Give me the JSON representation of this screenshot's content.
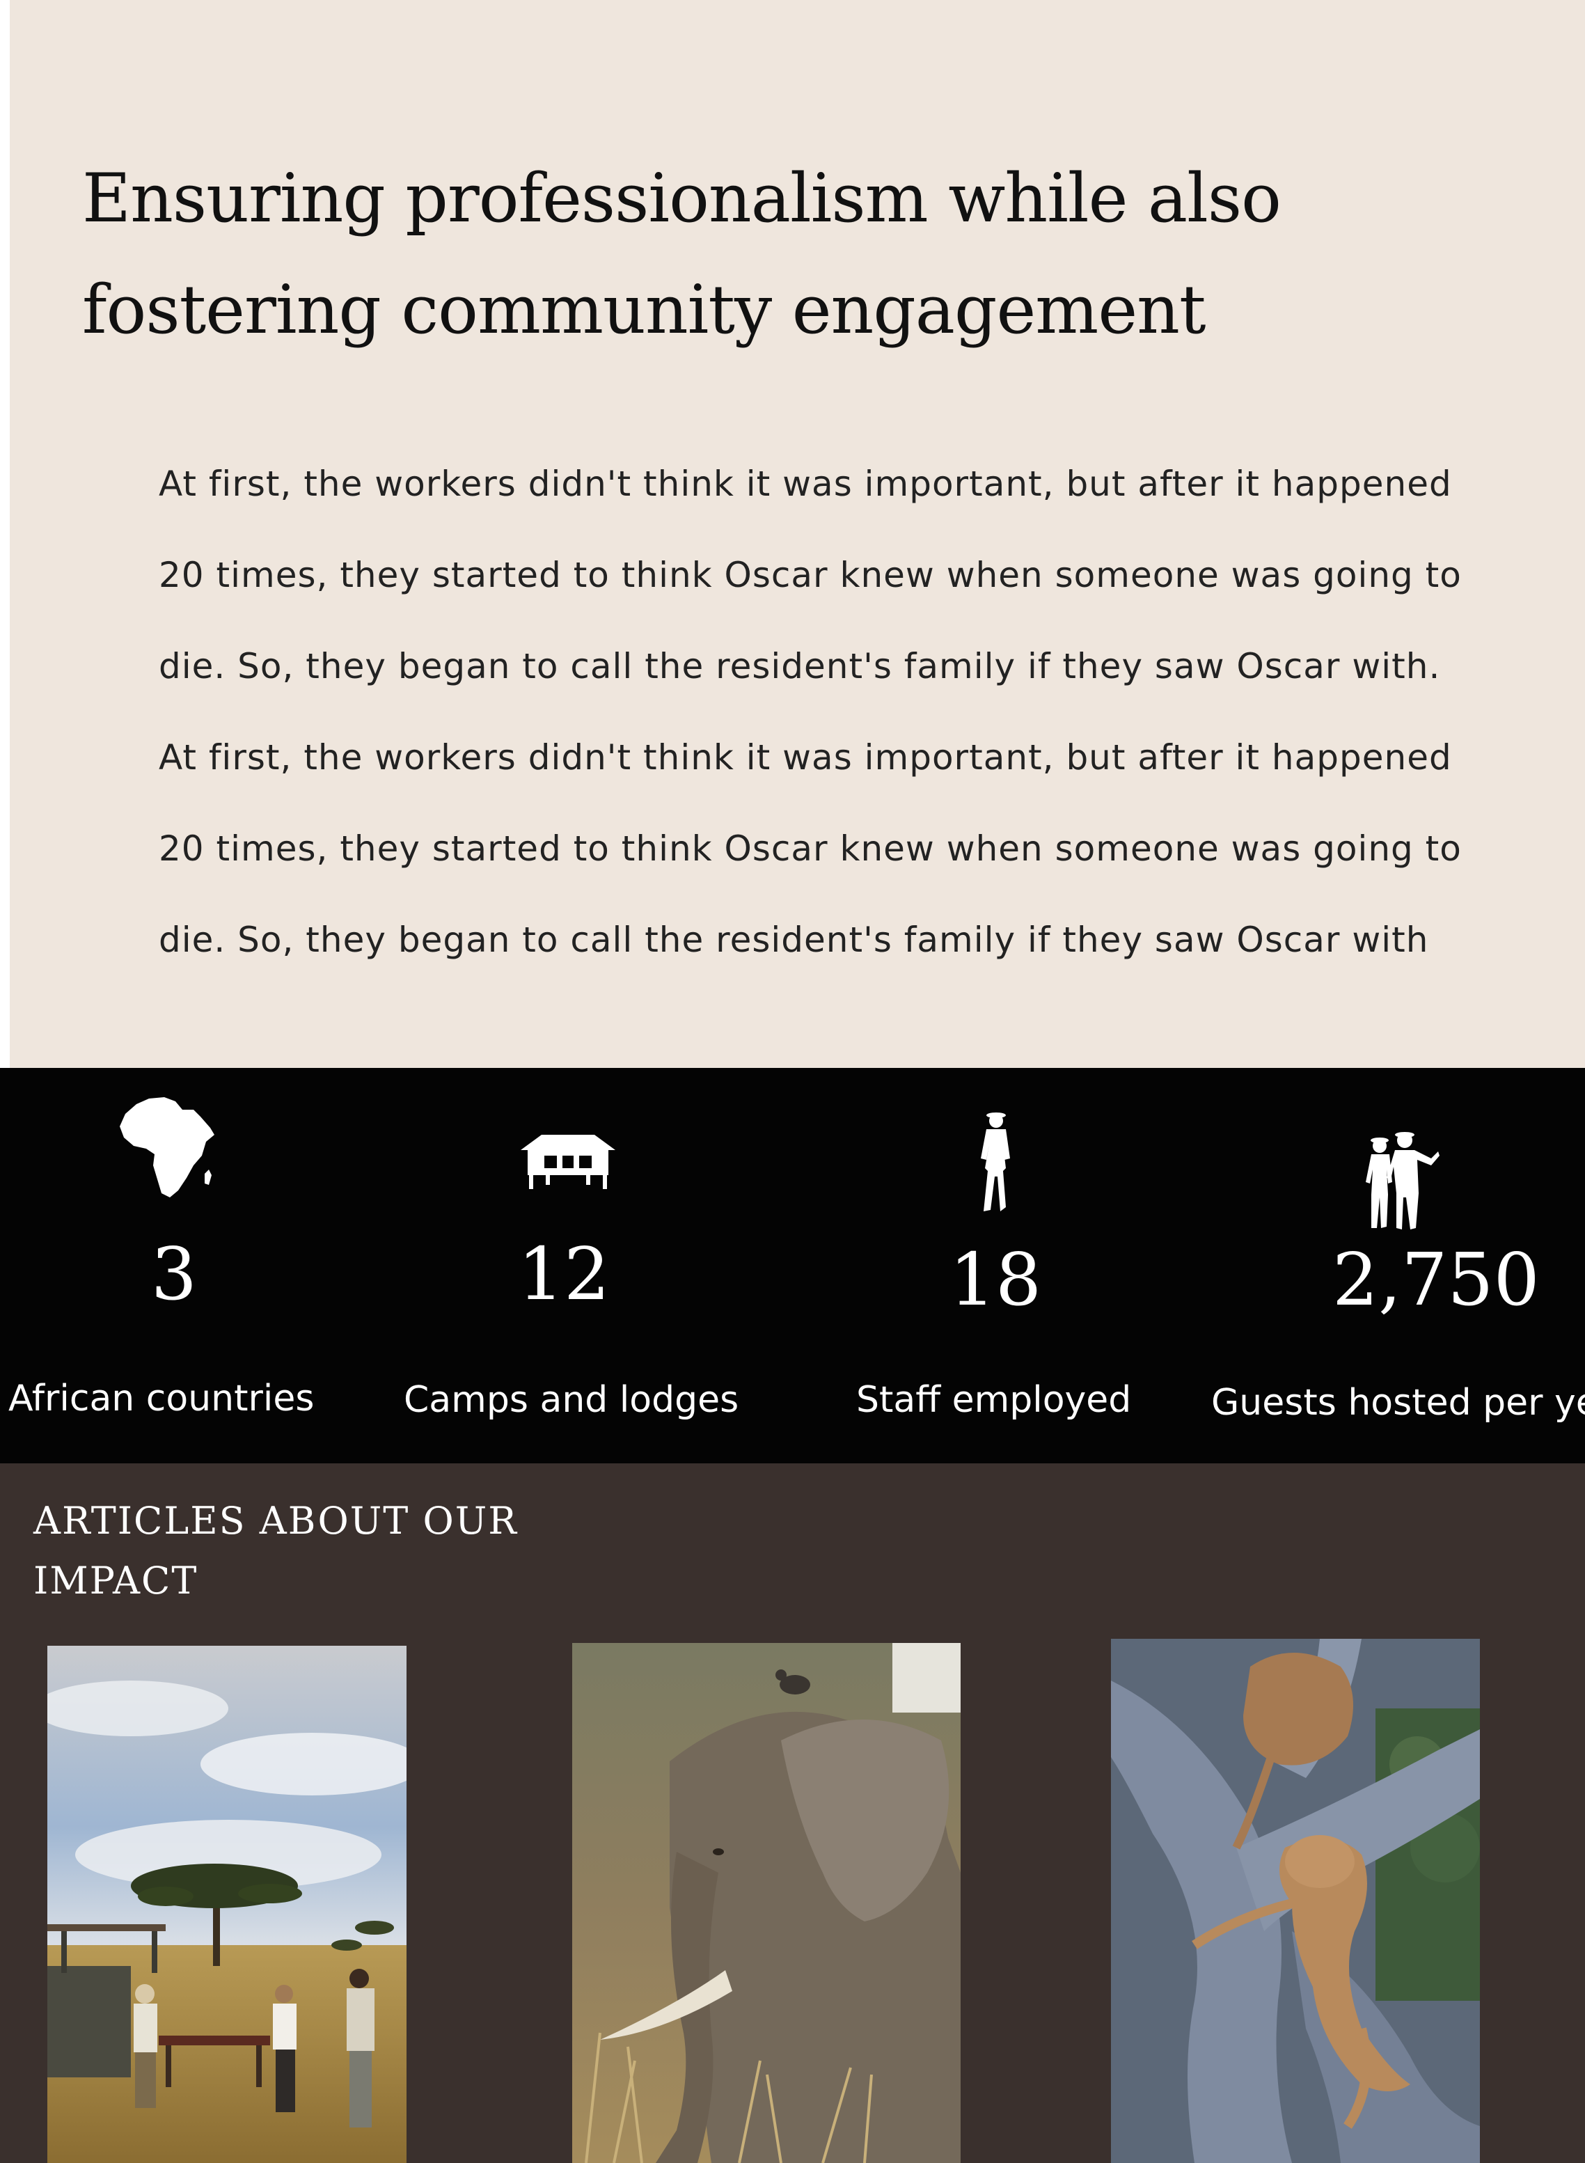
{
  "intro": {
    "heading": "Ensuring professionalism while also fostering community engagement",
    "body_lines": [
      "At first, the workers didn't think it was important, but after it happened",
      "20 times, they started to think Oscar knew when someone was going to",
      "die. So, they began to call the resident's family if they saw Oscar with.",
      "At first, the workers didn't think it was important, but after it happened",
      "20 times, they started to think Oscar knew when someone was going to",
      "die. So, they began to call the resident's family if they saw Oscar with"
    ]
  },
  "stats": [
    {
      "icon": "africa-map-icon",
      "value": "3",
      "label": "African countries"
    },
    {
      "icon": "tent-lodge-icon",
      "value": "12",
      "label": "Camps and lodges"
    },
    {
      "icon": "staff-person-icon",
      "value": "18",
      "label": "Staff employed"
    },
    {
      "icon": "guests-people-icon",
      "value": "2,750",
      "label": "Guests hosted per yea"
    }
  ],
  "articles": {
    "heading_line1": "ARTICLES ABOUT OUR",
    "heading_line2": "IMPACT",
    "cards": [
      {
        "image": "safari-picnic-savanna-photo"
      },
      {
        "image": "elephant-with-bird-photo"
      },
      {
        "image": "lions-in-tree-photo"
      }
    ]
  },
  "colors": {
    "intro_background": "#efe6dd",
    "stats_background": "#040404",
    "articles_background": "#3a302d",
    "text_dark": "#111111",
    "text_light": "#ffffff"
  }
}
